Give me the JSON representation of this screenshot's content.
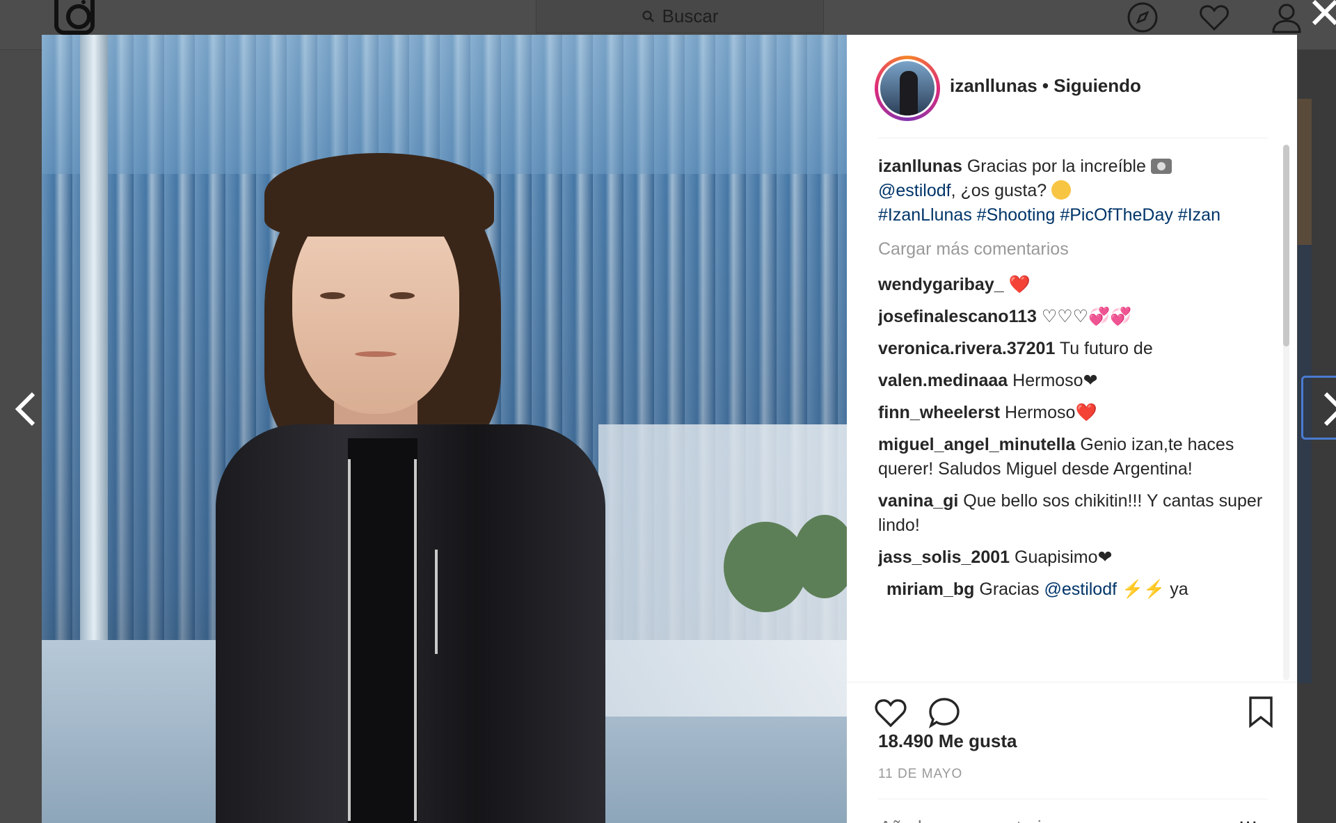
{
  "topnav": {
    "search_label": "Buscar"
  },
  "post": {
    "header_user": "izanllunas • Siguiendo",
    "caption": {
      "user": "izanllunas",
      "text_before": " Gracias por la increíble ",
      "mention": "@estilodf",
      "text_after": ", ¿os gusta? ",
      "hashtags": "#IzanLlunas #Shooting #PicOfTheDay #Izan"
    },
    "load_more": "Cargar más comentarios",
    "comments": [
      {
        "user": "wendygaribay_",
        "text": " ",
        "emoji": "❤️"
      },
      {
        "user": "josefinalescano113",
        "text": " ♡♡♡",
        "emoji": "💞💞"
      },
      {
        "user": "veronica.rivera.37201",
        "text": " Tu futuro de",
        "emoji": ""
      },
      {
        "user": "valen.medinaaa",
        "text": " Hermoso❤",
        "emoji": ""
      },
      {
        "user": "finn_wheelerst",
        "text": " Hermoso",
        "emoji": "❤️"
      },
      {
        "user": "miguel_angel_minutella",
        "text": " Genio izan,te haces querer! Saludos Miguel desde Argentina!",
        "emoji": ""
      },
      {
        "user": "vanina_gi",
        "text": " Que bello sos chikitin!!! Y cantas super lindo!",
        "emoji": ""
      },
      {
        "user": "jass_solis_2001",
        "text": " Guapisimo❤",
        "emoji": ""
      }
    ],
    "last_comment": {
      "user": "miriam_bg",
      "text_before": " Gracias ",
      "mention": "@estilodf",
      "text_after": " ya",
      "emoji": "⚡⚡"
    },
    "likes": "18.490 Me gusta",
    "date": "11 DE MAYO",
    "comment_placeholder": "Añade un comentario...",
    "more_label": "..."
  }
}
